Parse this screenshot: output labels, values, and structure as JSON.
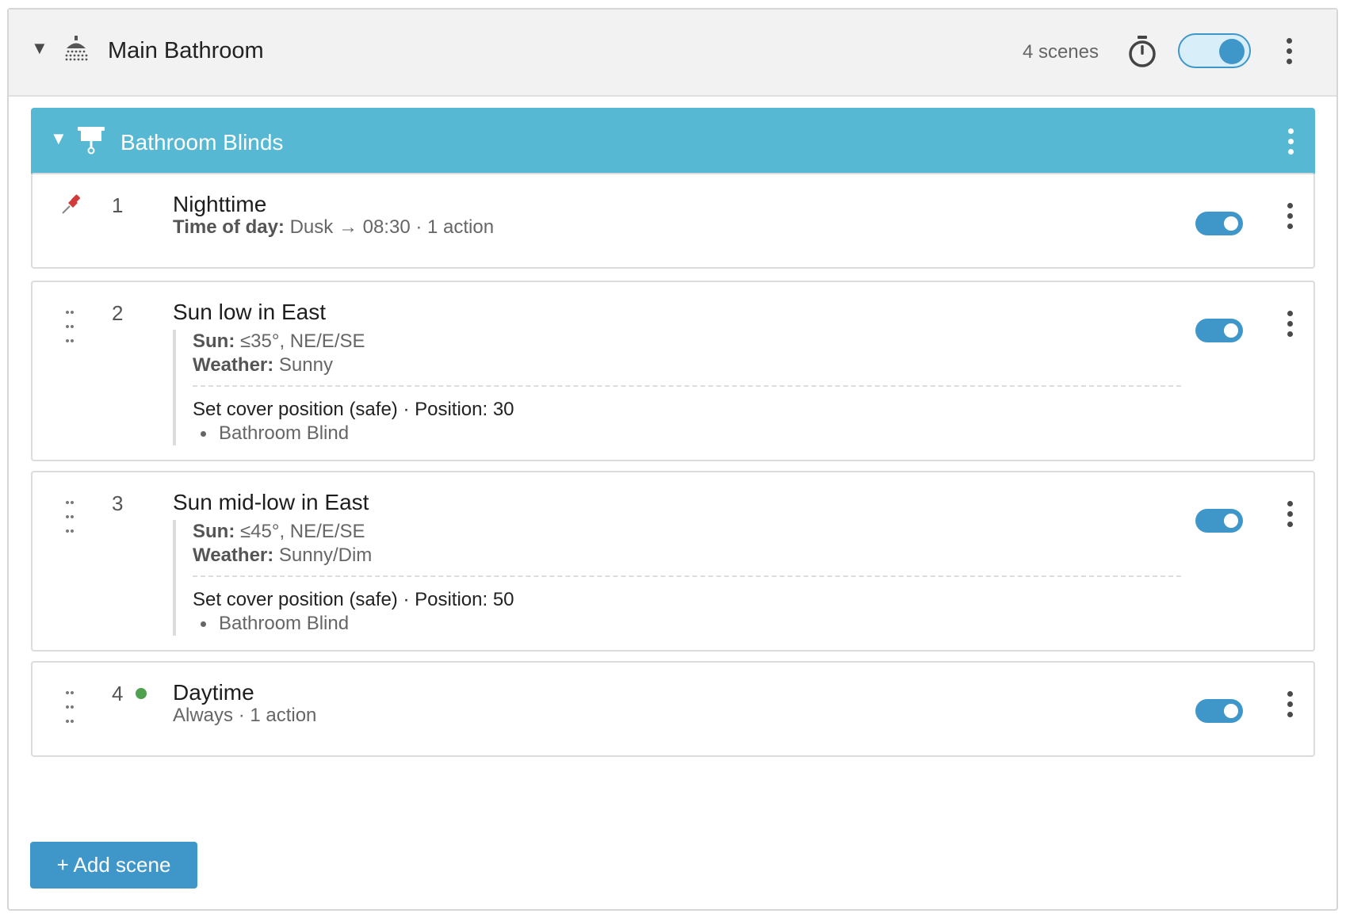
{
  "room": {
    "name": "Main Bathroom",
    "scene_count": "4 scenes",
    "enabled": true,
    "icon": "shower-icon"
  },
  "group": {
    "name": "Bathroom Blinds",
    "icon": "blinds-icon"
  },
  "scenes": [
    {
      "number": "1",
      "name": "Nighttime",
      "pinned": true,
      "summary_label": "Time of day:",
      "summary_value": "Dusk → 08:30 · 1 action",
      "enabled": true
    },
    {
      "number": "2",
      "name": "Sun low in East",
      "conditions": [
        {
          "label": "Sun:",
          "value": "≤35°, NE/E/SE"
        },
        {
          "label": "Weather:",
          "value": "Sunny"
        }
      ],
      "action": "Set cover position (safe) · Position: 30",
      "target": "Bathroom Blind",
      "enabled": true
    },
    {
      "number": "3",
      "name": "Sun mid-low in East",
      "conditions": [
        {
          "label": "Sun:",
          "value": "≤45°, NE/E/SE"
        },
        {
          "label": "Weather:",
          "value": "Sunny/Dim"
        }
      ],
      "action": "Set cover position (safe) · Position: 50",
      "target": "Bathroom Blind",
      "enabled": true
    },
    {
      "number": "4",
      "name": "Daytime",
      "active": true,
      "summary_value": "Always · 1 action",
      "enabled": true
    }
  ],
  "add_scene_label": "+ Add scene",
  "colors": {
    "accent": "#3f97c9",
    "group_header": "#56b8d3",
    "active_dot": "#4fa14f",
    "pin": "#d23b3b"
  }
}
